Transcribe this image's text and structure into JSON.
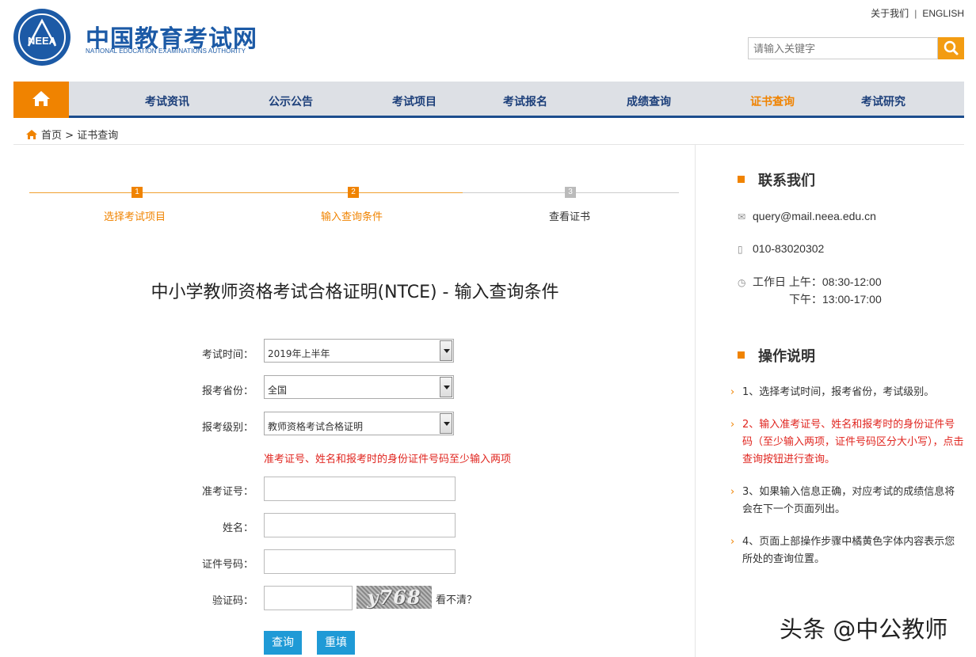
{
  "header": {
    "logo_cn": "中国教育考试网",
    "logo_en": "NATIONAL EDUCATION EXAMINATIONS AUTHORITY",
    "logo_badge": "NEEA",
    "about_link": "关于我们",
    "english_link": "ENGLISH",
    "search_placeholder": "请输入关键字"
  },
  "nav": {
    "items": [
      {
        "label": "考试资讯"
      },
      {
        "label": "公示公告"
      },
      {
        "label": "考试项目"
      },
      {
        "label": "考试报名"
      },
      {
        "label": "成绩查询"
      },
      {
        "label": "证书查询",
        "active": true
      },
      {
        "label": "考试研究"
      }
    ]
  },
  "breadcrumb": {
    "home": "首页",
    "separator": ">",
    "current": "证书查询"
  },
  "steps": [
    {
      "num": "1",
      "label": "选择考试项目",
      "state": "done"
    },
    {
      "num": "2",
      "label": "输入查询条件",
      "state": "current"
    },
    {
      "num": "3",
      "label": "查看证书",
      "state": "pending"
    }
  ],
  "form": {
    "title": "中小学教师资格考试合格证明(NTCE) - 输入查询条件",
    "exam_time_label": "考试时间：",
    "exam_time_value": "2019年上半年",
    "province_label": "报考省份：",
    "province_value": "全国",
    "level_label": "报考级别：",
    "level_value": "教师资格考试合格证明",
    "hint": "准考证号、姓名和报考时的身份证件号码至少输入两项",
    "ticket_label": "准考证号：",
    "name_label": "姓名：",
    "id_label": "证件号码：",
    "captcha_label": "验证码：",
    "captcha_text": "y768",
    "captcha_refresh": "看不清？",
    "submit": "查询",
    "reset": "重填"
  },
  "sidebar": {
    "contact_title": "联系我们",
    "email": "query@mail.neea.edu.cn",
    "phone": "010-83020302",
    "hours_1": "工作日 上午：08:30-12:00",
    "hours_2": "下午：13:00-17:00",
    "instructions_title": "操作说明",
    "instructions": [
      "1、选择考试时间，报考省份，考试级别。",
      "2、输入准考证号、姓名和报考时的身份证件号码（至少输入两项，证件号码区分大小写），点击查询按钮进行查询。",
      "3、如果输入信息正确，对应考试的成绩信息将会在下一个页面列出。",
      "4、页面上部操作步骤中橘黄色字体内容表示您所处的查询位置。"
    ]
  },
  "watermark": "头条 @中公教师",
  "colors": {
    "accent": "#f08300",
    "brand_blue": "#1c5aa6",
    "nav_bg": "#dde0e5",
    "button": "#1f9ad6",
    "hint_red": "#e0251f"
  }
}
